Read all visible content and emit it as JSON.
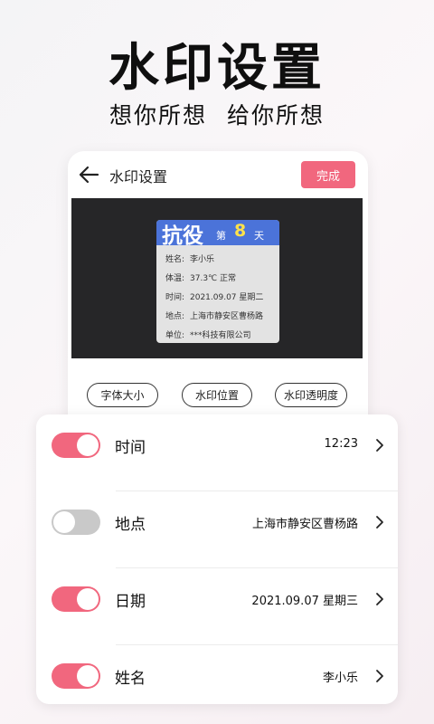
{
  "hero": {
    "title": "水印设置",
    "subtitle_left": "想你所想",
    "subtitle_right": "给你所想"
  },
  "topbar": {
    "back_icon": "arrow-left-icon",
    "title": "水印设置",
    "done_label": "完成"
  },
  "watermark": {
    "big_char_1": "抗",
    "big_char_2": "役",
    "di": "第",
    "day_number": "8",
    "tian": "天",
    "lines": [
      {
        "key": "姓名:",
        "value": "李小乐"
      },
      {
        "key": "体温:",
        "value": "37.3℃  正常"
      },
      {
        "key": "时间:",
        "value": "2021.09.07  星期二"
      },
      {
        "key": "地点:",
        "value": "上海市静安区曹杨路"
      },
      {
        "key": "单位:",
        "value": "***科技有限公司"
      }
    ]
  },
  "chips": [
    "字体大小",
    "水印位置",
    "水印透明度"
  ],
  "settings": [
    {
      "label": "时间",
      "value": "12:23",
      "enabled": true
    },
    {
      "label": "地点",
      "value": "上海市静安区曹杨路",
      "enabled": false
    },
    {
      "label": "日期",
      "value": "2021.09.07 星期三",
      "enabled": true
    },
    {
      "label": "姓名",
      "value": "李小乐",
      "enabled": true
    }
  ],
  "colors": {
    "accent": "#f1677e",
    "toggle_off": "#c9c9c9",
    "watermark_header": "#4b73d9",
    "day_number": "#ffe24a",
    "preview_bg": "#262628"
  }
}
